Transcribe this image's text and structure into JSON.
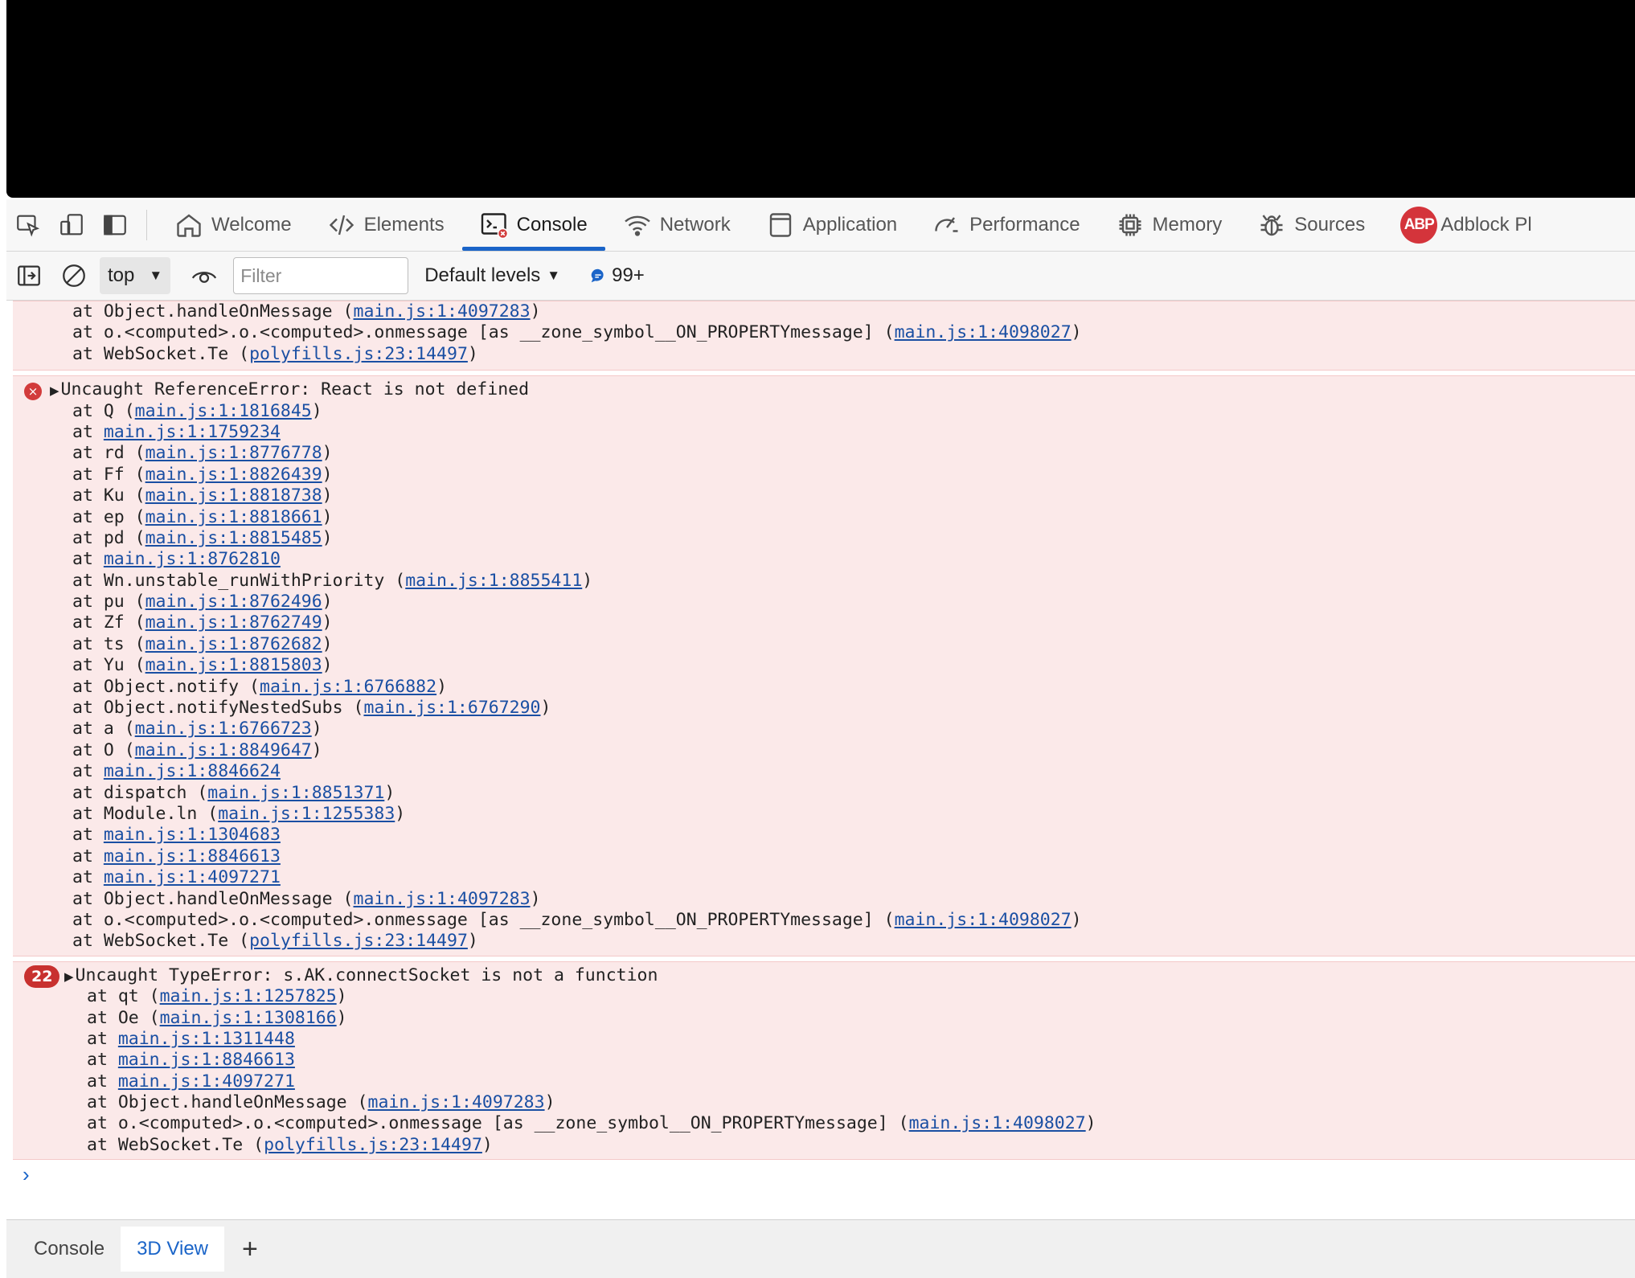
{
  "tabs": [
    {
      "label": "Welcome",
      "icon": "home-icon"
    },
    {
      "label": "Elements",
      "icon": "code-icon"
    },
    {
      "label": "Console",
      "icon": "console-icon",
      "active": true
    },
    {
      "label": "Network",
      "icon": "wifi-icon"
    },
    {
      "label": "Application",
      "icon": "application-icon"
    },
    {
      "label": "Performance",
      "icon": "performance-icon"
    },
    {
      "label": "Memory",
      "icon": "memory-chip-icon"
    },
    {
      "label": "Sources",
      "icon": "bug-icon"
    },
    {
      "label": "Adblock Pl",
      "icon": "abp-icon",
      "icon_text": "ABP"
    }
  ],
  "toolbar": {
    "context": "top",
    "filter_placeholder": "Filter",
    "levels": "Default levels",
    "issues_count": "99+"
  },
  "colors": {
    "error_bg": "#fbe9e9",
    "link": "#1a4fa3",
    "accent": "#1a64c8",
    "error_red": "#d23b3b"
  },
  "entries": [
    {
      "type": "tail",
      "lines": [
        [
          {
            "t": "at Object.handleOnMessage ("
          },
          {
            "t": "main.js:1:4097283",
            "link": true
          },
          {
            "t": ")"
          }
        ],
        [
          {
            "t": "at o.<computed>.o.<computed>.onmessage [as __zone_symbol__ON_PROPERTYmessage] ("
          },
          {
            "t": "main.js:1:4098027",
            "link": true
          },
          {
            "t": ")"
          }
        ],
        [
          {
            "t": "at WebSocket.Te ("
          },
          {
            "t": "polyfills.js:23:14497",
            "link": true
          },
          {
            "t": ")"
          }
        ]
      ]
    },
    {
      "type": "error",
      "icon": "×",
      "lines": [
        [
          {
            "t": "Uncaught ReferenceError: React is not defined"
          }
        ],
        [
          {
            "t": "at Q ("
          },
          {
            "t": "main.js:1:1816845",
            "link": true
          },
          {
            "t": ")"
          }
        ],
        [
          {
            "t": "at "
          },
          {
            "t": "main.js:1:1759234",
            "link": true
          }
        ],
        [
          {
            "t": "at rd ("
          },
          {
            "t": "main.js:1:8776778",
            "link": true
          },
          {
            "t": ")"
          }
        ],
        [
          {
            "t": "at Ff ("
          },
          {
            "t": "main.js:1:8826439",
            "link": true
          },
          {
            "t": ")"
          }
        ],
        [
          {
            "t": "at Ku ("
          },
          {
            "t": "main.js:1:8818738",
            "link": true
          },
          {
            "t": ")"
          }
        ],
        [
          {
            "t": "at ep ("
          },
          {
            "t": "main.js:1:8818661",
            "link": true
          },
          {
            "t": ")"
          }
        ],
        [
          {
            "t": "at pd ("
          },
          {
            "t": "main.js:1:8815485",
            "link": true
          },
          {
            "t": ")"
          }
        ],
        [
          {
            "t": "at "
          },
          {
            "t": "main.js:1:8762810",
            "link": true
          }
        ],
        [
          {
            "t": "at Wn.unstable_runWithPriority ("
          },
          {
            "t": "main.js:1:8855411",
            "link": true
          },
          {
            "t": ")"
          }
        ],
        [
          {
            "t": "at pu ("
          },
          {
            "t": "main.js:1:8762496",
            "link": true
          },
          {
            "t": ")"
          }
        ],
        [
          {
            "t": "at Zf ("
          },
          {
            "t": "main.js:1:8762749",
            "link": true
          },
          {
            "t": ")"
          }
        ],
        [
          {
            "t": "at ts ("
          },
          {
            "t": "main.js:1:8762682",
            "link": true
          },
          {
            "t": ")"
          }
        ],
        [
          {
            "t": "at Yu ("
          },
          {
            "t": "main.js:1:8815803",
            "link": true
          },
          {
            "t": ")"
          }
        ],
        [
          {
            "t": "at Object.notify ("
          },
          {
            "t": "main.js:1:6766882",
            "link": true
          },
          {
            "t": ")"
          }
        ],
        [
          {
            "t": "at Object.notifyNestedSubs ("
          },
          {
            "t": "main.js:1:6767290",
            "link": true
          },
          {
            "t": ")"
          }
        ],
        [
          {
            "t": "at a ("
          },
          {
            "t": "main.js:1:6766723",
            "link": true
          },
          {
            "t": ")"
          }
        ],
        [
          {
            "t": "at O ("
          },
          {
            "t": "main.js:1:8849647",
            "link": true
          },
          {
            "t": ")"
          }
        ],
        [
          {
            "t": "at "
          },
          {
            "t": "main.js:1:8846624",
            "link": true
          }
        ],
        [
          {
            "t": "at dispatch ("
          },
          {
            "t": "main.js:1:8851371",
            "link": true
          },
          {
            "t": ")"
          }
        ],
        [
          {
            "t": "at Module.ln ("
          },
          {
            "t": "main.js:1:1255383",
            "link": true
          },
          {
            "t": ")"
          }
        ],
        [
          {
            "t": "at "
          },
          {
            "t": "main.js:1:1304683",
            "link": true
          }
        ],
        [
          {
            "t": "at "
          },
          {
            "t": "main.js:1:8846613",
            "link": true
          }
        ],
        [
          {
            "t": "at "
          },
          {
            "t": "main.js:1:4097271",
            "link": true
          }
        ],
        [
          {
            "t": "at Object.handleOnMessage ("
          },
          {
            "t": "main.js:1:4097283",
            "link": true
          },
          {
            "t": ")"
          }
        ],
        [
          {
            "t": "at o.<computed>.o.<computed>.onmessage [as __zone_symbol__ON_PROPERTYmessage] ("
          },
          {
            "t": "main.js:1:4098027",
            "link": true
          },
          {
            "t": ")"
          }
        ],
        [
          {
            "t": "at WebSocket.Te ("
          },
          {
            "t": "polyfills.js:23:14497",
            "link": true
          },
          {
            "t": ")"
          }
        ]
      ]
    },
    {
      "type": "error",
      "count": "22",
      "lines": [
        [
          {
            "t": "Uncaught TypeError: s.AK.connectSocket is not a function"
          }
        ],
        [
          {
            "t": "at qt ("
          },
          {
            "t": "main.js:1:1257825",
            "link": true
          },
          {
            "t": ")"
          }
        ],
        [
          {
            "t": "at Oe ("
          },
          {
            "t": "main.js:1:1308166",
            "link": true
          },
          {
            "t": ")"
          }
        ],
        [
          {
            "t": "at "
          },
          {
            "t": "main.js:1:1311448",
            "link": true
          }
        ],
        [
          {
            "t": "at "
          },
          {
            "t": "main.js:1:8846613",
            "link": true
          }
        ],
        [
          {
            "t": "at "
          },
          {
            "t": "main.js:1:4097271",
            "link": true
          }
        ],
        [
          {
            "t": "at Object.handleOnMessage ("
          },
          {
            "t": "main.js:1:4097283",
            "link": true
          },
          {
            "t": ")"
          }
        ],
        [
          {
            "t": "at o.<computed>.o.<computed>.onmessage [as __zone_symbol__ON_PROPERTYmessage] ("
          },
          {
            "t": "main.js:1:4098027",
            "link": true
          },
          {
            "t": ")"
          }
        ],
        [
          {
            "t": "at WebSocket.Te ("
          },
          {
            "t": "polyfills.js:23:14497",
            "link": true
          },
          {
            "t": ")"
          }
        ]
      ]
    }
  ],
  "prompt": "›",
  "drawer": {
    "tabs": [
      {
        "label": "Console"
      },
      {
        "label": "3D View",
        "active": true
      }
    ],
    "add": "+"
  }
}
